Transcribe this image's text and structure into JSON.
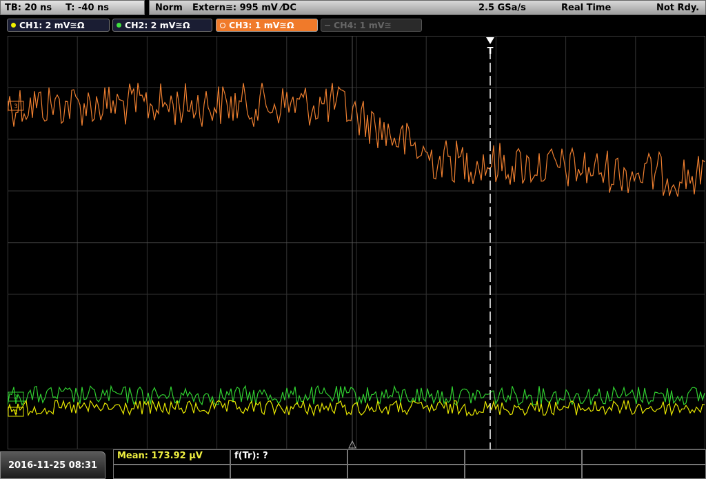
{
  "timebase": {
    "tb_label": "TB: 20 ns",
    "t_label": "T: -40 ns"
  },
  "status": {
    "mode": "Norm",
    "trigger": "Extern≅: 995 mV ⁄DC",
    "sample_rate": "2.5 GSa/s",
    "acq_mode": "Real Time",
    "state": "Not Rdy."
  },
  "channels": [
    {
      "label": "CH1: 2 mV≅Ω",
      "color": "#f0f000",
      "active": true
    },
    {
      "label": "CH2: 2 mV≅Ω",
      "color": "#40e040",
      "active": true
    },
    {
      "label": "CH3: 1 mV≅Ω",
      "color": "#f07a2a",
      "active": true,
      "selected": true
    },
    {
      "label": "CH4: 1 mV≅",
      "color": "#555555",
      "active": false
    }
  ],
  "trigger_marker": "T",
  "datetime": "2016-11-25 08:31",
  "measurements": {
    "mean": "Mean: 173.92 µV",
    "ftr": "f(Tr): ?"
  },
  "colors": {
    "grid": "#4a4a4a",
    "ch1": "#e8e800",
    "ch2": "#30d030",
    "ch3": "#f08030"
  }
}
